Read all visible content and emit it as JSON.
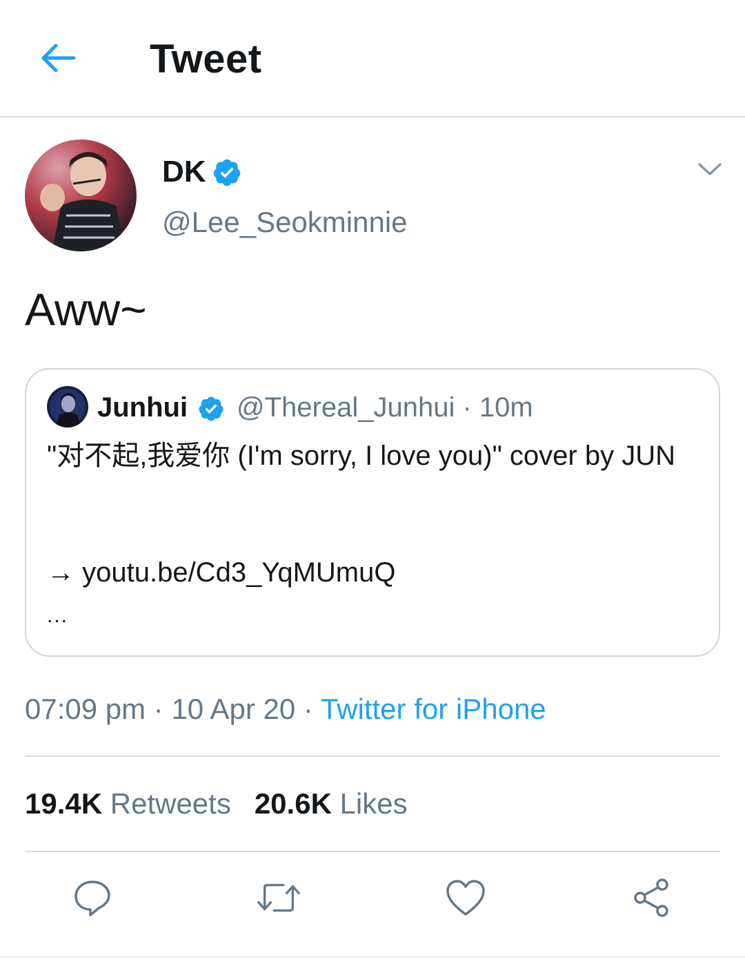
{
  "header": {
    "title": "Tweet"
  },
  "tweet": {
    "author_name": "DK",
    "author_handle": "@Lee_Seokminnie",
    "text": "Aww~",
    "time": "07:09 pm",
    "date": "10 Apr 20",
    "source": "Twitter for iPhone",
    "sep": " · "
  },
  "quote": {
    "author_name": "Junhui",
    "author_handle": "@Thereal_Junhui",
    "age": "10m",
    "sep": " · ",
    "body": "\"对不起,我爱你 (I'm sorry, I love you)\" cover by JUN",
    "link": "→ youtu.be/Cd3_YqMUmuQ",
    "ellipsis": "..."
  },
  "stats": {
    "retweets_count": "19.4K",
    "retweets_label": "Retweets",
    "likes_count": "20.6K",
    "likes_label": "Likes"
  },
  "icons": {
    "back": "back-arrow-icon",
    "verified": "verified-badge-icon",
    "caret": "chevron-down-icon",
    "reply": "reply-icon",
    "retweet": "retweet-icon",
    "like": "heart-icon",
    "share": "share-icon"
  },
  "colors": {
    "accent": "#1da1f2",
    "secondary_text": "#657786",
    "primary_text": "#14171a",
    "divider": "#d6dde3"
  }
}
